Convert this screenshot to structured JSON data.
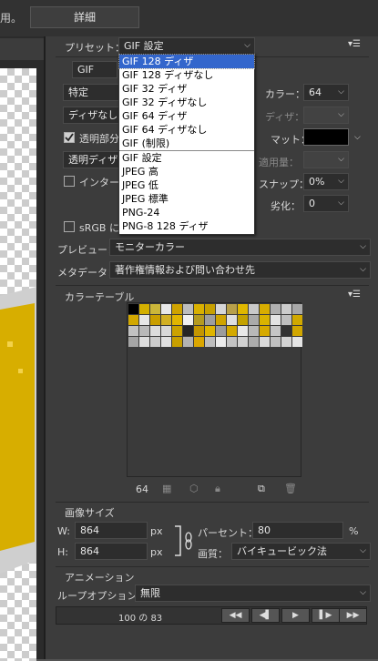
{
  "top": {
    "left_text": "用。",
    "detail_button": "詳細"
  },
  "preset": {
    "label": "プリセット：",
    "value": "GIF 設定"
  },
  "format": {
    "value": "GIF"
  },
  "left_controls": {
    "reduction": "特定",
    "dither_algo": "ディザなし",
    "transparency_label": "透明部分",
    "transparency_dither": "透明ディザなし",
    "interlace_label": "インターレース",
    "srgb_label": "sRGB に変換"
  },
  "right_controls": {
    "colors_label": "カラー：",
    "colors_value": "64",
    "dither_label": "ディザ：",
    "matte_label": "マット：",
    "amount_label": "適用量：",
    "snap_label": "スナップ：",
    "snap_value": "0%",
    "lossy_label": "劣化：",
    "lossy_value": "0"
  },
  "preview": {
    "label": "プレビュー：",
    "value": "モニターカラー"
  },
  "metadata": {
    "label": "メタデータ：",
    "value": "著作権情報および問い合わせ先"
  },
  "color_table": {
    "title": "カラーテーブル",
    "count": "64",
    "swatches": [
      "#000000",
      "#d4b000",
      "#cbb63a",
      "#e8e8e8",
      "#cfa300",
      "#bdbdbd",
      "#d9b000",
      "#c7a000",
      "#d6d6d6",
      "#b8a04a",
      "#e0b800",
      "#c9c9c9",
      "#d8ad00",
      "#b0b0b0",
      "#cccccc",
      "#a8a8a8",
      "#d2a800",
      "#e6e6e6",
      "#c99e00",
      "#d2b024",
      "#e1b500",
      "#f0f0f0",
      "#b59b20",
      "#9e9e9e",
      "#cfa400",
      "#dfdfdf",
      "#c4a200",
      "#aaaaaa",
      "#d9b300",
      "#e3e3e3",
      "#bfbfbf",
      "#d1a900",
      "#c2c2c2",
      "#b9b9b9",
      "#dcdcdc",
      "#d8d8d8",
      "#cba200",
      "#252525",
      "#c49600",
      "#dfb500",
      "#9c9c9c",
      "#d3a900",
      "#e8e8e8",
      "#b8b8b8",
      "#d6aa00",
      "#c5c5c5",
      "#333333",
      "#d2a700",
      "#a5a5a5",
      "#dddddd",
      "#cccccc",
      "#e0e0e0",
      "#c8a000",
      "#b3b3b3",
      "#daa600",
      "#bdbdbd",
      "#ebebeb",
      "#c3c3c3",
      "#d1d1d1",
      "#acacac",
      "#dadada",
      "#c0c0c0",
      "#d4d4d4",
      "#e5e5e5"
    ]
  },
  "image_size": {
    "title": "画像サイズ",
    "w_label": "W:",
    "w_value": "864",
    "w_unit": "px",
    "h_label": "H:",
    "h_value": "864",
    "h_unit": "px",
    "percent_label": "パーセント：",
    "percent_value": "80",
    "percent_unit": "%",
    "quality_label": "画質：",
    "quality_value": "バイキュービック法"
  },
  "animation": {
    "title": "アニメーション",
    "loop_label": "ループオプション：",
    "loop_value": "無限",
    "frame_label": "100 の 83"
  },
  "dropdown_items": [
    {
      "label": "GIF 128 ディザ",
      "selected": true
    },
    {
      "label": "GIF 128 ディザなし",
      "selected": false
    },
    {
      "label": "GIF 32 ディザ",
      "selected": false
    },
    {
      "label": "GIF 32 ディザなし",
      "selected": false
    },
    {
      "label": "GIF 64 ディザ",
      "selected": false
    },
    {
      "label": "GIF 64 ディザなし",
      "selected": false
    },
    {
      "label": "GIF (制限)",
      "selected": false
    },
    {
      "label": "GIF 設定",
      "selected": false
    },
    {
      "label": "JPEG 高",
      "selected": false
    },
    {
      "label": "JPEG 低",
      "selected": false
    },
    {
      "label": "JPEG 標準",
      "selected": false
    },
    {
      "label": "PNG-24",
      "selected": false
    },
    {
      "label": "PNG-8 128 ディザ",
      "selected": false
    }
  ],
  "colors": {
    "panel_bg": "#3c3c3c",
    "field_bg": "#2d2d2d",
    "selection": "#3366cc",
    "accent_yellow": "#d4b000"
  }
}
